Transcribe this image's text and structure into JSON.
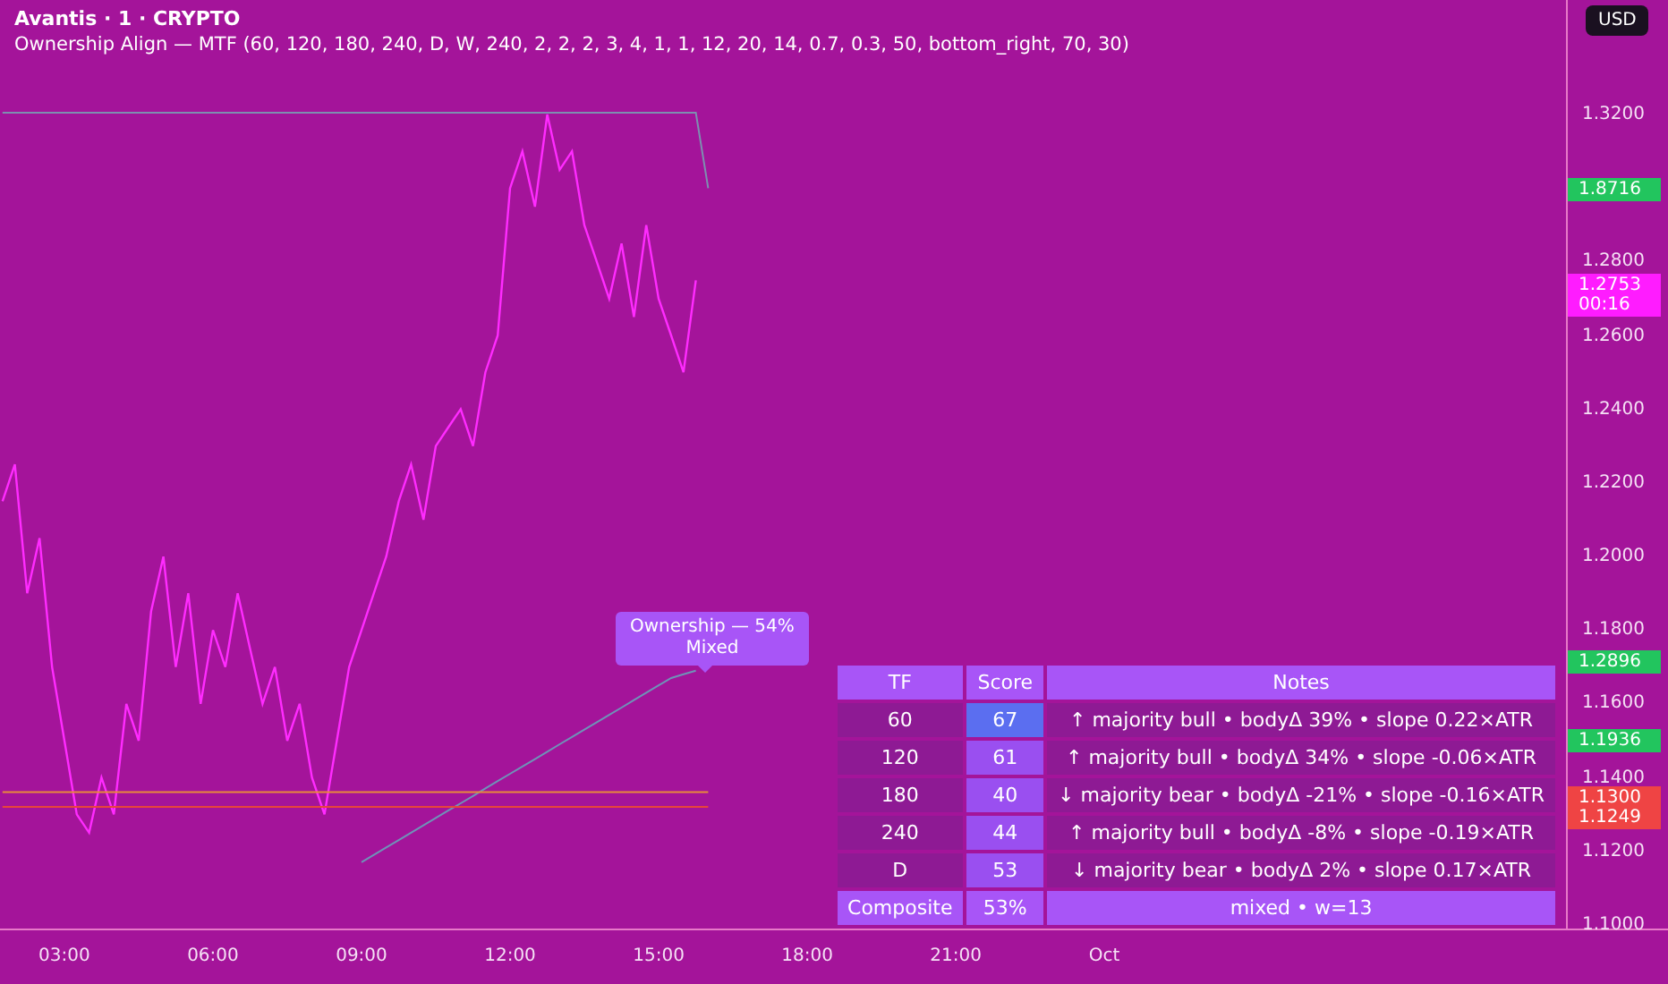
{
  "header": {
    "symbol": "Avantis · 1 · CRYPTO",
    "indicator": "Ownership Align — MTF (60, 120, 180, 240, D, W, 240, 2, 2, 2, 3, 4, 1, 1, 12, 20, 14, 0.7, 0.3, 50, bottom_right, 70, 30)"
  },
  "currency_button": "USD",
  "chart": {
    "chart_data": {
      "type": "line",
      "x": [
        1.75,
        2,
        2.25,
        2.5,
        2.75,
        3,
        3.25,
        3.5,
        3.75,
        4,
        4.25,
        4.5,
        4.75,
        5,
        5.25,
        5.5,
        5.75,
        6,
        6.25,
        6.5,
        6.75,
        7,
        7.25,
        7.5,
        7.75,
        8,
        8.25,
        8.5,
        8.75,
        9,
        9.25,
        9.5,
        9.75,
        10,
        10.25,
        10.5,
        10.75,
        11,
        11.25,
        11.5,
        11.75,
        12,
        12.25,
        12.5,
        12.75,
        13,
        13.25,
        13.5,
        13.75,
        14,
        14.25,
        14.5,
        14.75,
        15,
        15.25,
        15.5,
        15.75,
        16
      ],
      "series": [
        {
          "color": "#ff2bff",
          "values": [
            1.215,
            1.225,
            1.19,
            1.205,
            1.17,
            1.15,
            1.13,
            1.125,
            1.14,
            1.13,
            1.16,
            1.15,
            1.185,
            1.2,
            1.17,
            1.19,
            1.16,
            1.18,
            1.17,
            1.19,
            1.175,
            1.16,
            1.17,
            1.15,
            1.16,
            1.14,
            1.13,
            1.15,
            1.17,
            1.18,
            1.19,
            1.2,
            1.215,
            1.225,
            1.21,
            1.23,
            1.235,
            1.24,
            1.23,
            1.25,
            1.26,
            1.3,
            1.31,
            1.295,
            1.32,
            1.305,
            1.31,
            1.29,
            1.28,
            1.27,
            1.285,
            1.265,
            1.29,
            1.27,
            1.26,
            1.25,
            1.275,
            null
          ]
        },
        {
          "color": "#7d8fb0",
          "values": [
            1.3205,
            1.3205,
            1.3205,
            1.3205,
            1.3205,
            1.3205,
            1.3205,
            1.3205,
            1.3205,
            1.3205,
            1.3205,
            1.3205,
            1.3205,
            1.3205,
            1.3205,
            1.3205,
            1.3205,
            1.3205,
            1.3205,
            1.3205,
            1.3205,
            1.3205,
            1.3205,
            1.3205,
            1.3205,
            1.3205,
            1.3205,
            1.3205,
            1.3205,
            1.3205,
            1.3205,
            1.3205,
            1.3205,
            1.3205,
            1.3205,
            1.3205,
            1.3205,
            1.3205,
            1.3205,
            1.3205,
            1.3205,
            1.3205,
            1.3205,
            1.3205,
            1.3205,
            1.3205,
            1.3205,
            1.3205,
            1.3205,
            1.3205,
            1.3205,
            1.3205,
            1.3205,
            1.3205,
            1.3205,
            1.3205,
            1.3205,
            1.3
          ]
        },
        {
          "color": "#6f93b8",
          "values": [
            null,
            null,
            null,
            null,
            null,
            null,
            null,
            null,
            null,
            null,
            null,
            null,
            null,
            null,
            null,
            null,
            null,
            null,
            null,
            null,
            null,
            null,
            null,
            null,
            null,
            null,
            null,
            null,
            null,
            1.117,
            1.119,
            1.121,
            1.123,
            1.125,
            1.127,
            1.129,
            1.131,
            1.133,
            1.135,
            1.137,
            1.139,
            1.141,
            1.143,
            1.145,
            1.147,
            1.149,
            1.151,
            1.153,
            1.155,
            1.157,
            1.159,
            1.161,
            1.163,
            1.165,
            1.167,
            1.168,
            1.169,
            null
          ]
        },
        {
          "color": "#e88a3a",
          "values": [
            1.136,
            1.136,
            1.136,
            1.136,
            1.136,
            1.136,
            1.136,
            1.136,
            1.136,
            1.136,
            1.136,
            1.136,
            1.136,
            1.136,
            1.136,
            1.136,
            1.136,
            1.136,
            1.136,
            1.136,
            1.136,
            1.136,
            1.136,
            1.136,
            1.136,
            1.136,
            1.136,
            1.136,
            1.136,
            1.136,
            1.136,
            1.136,
            1.136,
            1.136,
            1.136,
            1.136,
            1.136,
            1.136,
            1.136,
            1.136,
            1.136,
            1.136,
            1.136,
            1.136,
            1.136,
            1.136,
            1.136,
            1.136,
            1.136,
            1.136,
            1.136,
            1.136,
            1.136,
            1.136,
            1.136,
            1.136,
            1.136,
            1.136
          ]
        },
        {
          "color": "#e8453a",
          "values": [
            1.132,
            1.132,
            1.132,
            1.132,
            1.132,
            1.132,
            1.132,
            1.132,
            1.132,
            1.132,
            1.132,
            1.132,
            1.132,
            1.132,
            1.132,
            1.132,
            1.132,
            1.132,
            1.132,
            1.132,
            1.132,
            1.132,
            1.132,
            1.132,
            1.132,
            1.132,
            1.132,
            1.132,
            1.132,
            1.132,
            1.132,
            1.132,
            1.132,
            1.132,
            1.132,
            1.132,
            1.132,
            1.132,
            1.132,
            1.132,
            1.132,
            1.132,
            1.132,
            1.132,
            1.132,
            1.132,
            1.132,
            1.132,
            1.132,
            1.132,
            1.132,
            1.132,
            1.132,
            1.132,
            1.132,
            1.132,
            1.132,
            1.132
          ]
        }
      ],
      "xlim": [
        1.7,
        35.38
      ],
      "ylim": [
        1.0985,
        1.3511
      ],
      "xticks": [
        {
          "value": 3,
          "label": "03:00"
        },
        {
          "value": 6,
          "label": "06:00"
        },
        {
          "value": 9,
          "label": "09:00"
        },
        {
          "value": 12,
          "label": "12:00"
        },
        {
          "value": 15,
          "label": "15:00"
        },
        {
          "value": 18,
          "label": "18:00"
        },
        {
          "value": 21,
          "label": "21:00"
        },
        {
          "value": 24,
          "label": "Oct"
        }
      ],
      "yticks": [
        {
          "value": 1.32,
          "label": "1.3200"
        },
        {
          "value": 1.28,
          "label": "1.2800"
        },
        {
          "value": 1.26,
          "label": "1.2600"
        },
        {
          "value": 1.24,
          "label": "1.2400"
        },
        {
          "value": 1.22,
          "label": "1.2200"
        },
        {
          "value": 1.2,
          "label": "1.2000"
        },
        {
          "value": 1.18,
          "label": "1.1800"
        },
        {
          "value": 1.16,
          "label": "1.1600"
        },
        {
          "value": 1.14,
          "label": "1.1400"
        },
        {
          "value": 1.12,
          "label": "1.1200"
        },
        {
          "value": 1.1,
          "label": "1.1000"
        }
      ]
    }
  },
  "price_tags": [
    {
      "label": "1.8716",
      "color": "#22c55e"
    },
    {
      "label": "1.2753",
      "sub": "00:16",
      "color": "#ff1cff"
    },
    {
      "label": "1.2896",
      "color": "#22c55e"
    },
    {
      "label": "1.1936",
      "color": "#22c55e"
    },
    {
      "label": "1.1300",
      "color": "#ef4444"
    },
    {
      "label": "1.1249",
      "color": "#ef4444"
    }
  ],
  "tooltip": {
    "title": "Ownership — 54%",
    "subtitle": "Mixed"
  },
  "table": {
    "columns": [
      "TF",
      "Score",
      "Notes"
    ],
    "rows": [
      {
        "tf": "60",
        "score": "67",
        "color": "#5b6ef0",
        "notes": "↑ majority bull • bodyΔ 39% • slope 0.22×ATR"
      },
      {
        "tf": "120",
        "score": "61",
        "color": "#9a4ff0",
        "notes": "↑ majority bull • bodyΔ 34% • slope -0.06×ATR"
      },
      {
        "tf": "180",
        "score": "40",
        "color": "#9a4ff0",
        "notes": "↓ majority bear • bodyΔ -21% • slope -0.16×ATR"
      },
      {
        "tf": "240",
        "score": "44",
        "color": "#9a4ff0",
        "notes": "↑ majority bull • bodyΔ -8% • slope -0.19×ATR"
      },
      {
        "tf": "D",
        "score": "53",
        "color": "#9a4ff0",
        "notes": "↓ majority bear • bodyΔ 2% • slope 0.17×ATR"
      }
    ],
    "footer": {
      "label": "Composite",
      "score": "53%",
      "notes": "mixed • w=13"
    }
  }
}
